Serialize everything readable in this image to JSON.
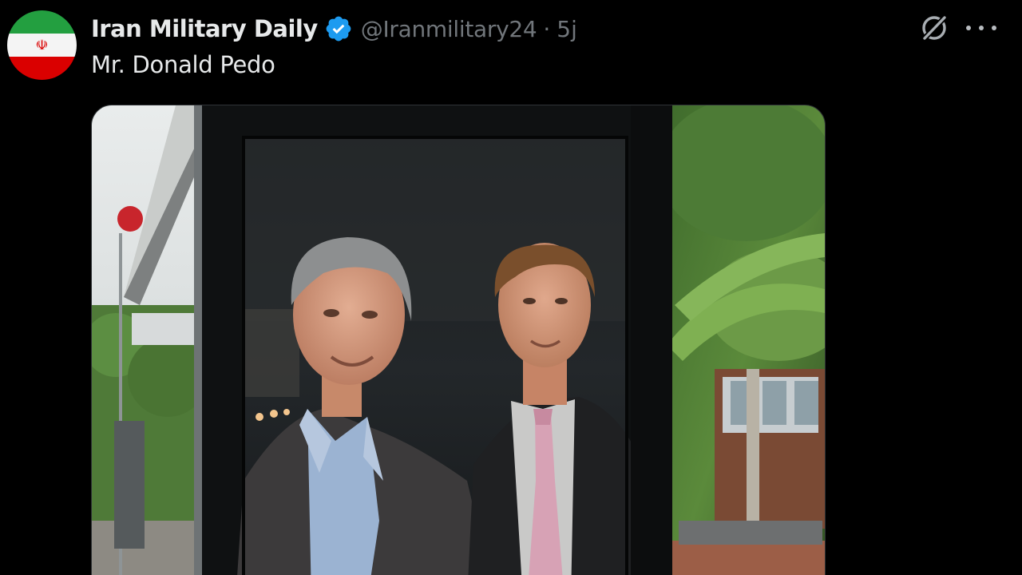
{
  "post": {
    "account_name": "Iran Military Daily",
    "handle": "@Iranmilitary24",
    "separator": "·",
    "timestamp": "5j",
    "text": "Mr. Donald Pedo",
    "verified": true
  },
  "icons": {
    "avatar": "iran-flag-avatar",
    "verified_badge": "verified-badge-icon",
    "grok": "grok-icon",
    "more": "more-options-icon"
  },
  "colors": {
    "background": "#000000",
    "primary_text": "#e7e9ea",
    "secondary_text": "#71767b",
    "verified": "#1d9bf0",
    "flag_green": "#239f40",
    "flag_white": "#ffffff",
    "flag_red": "#da0000"
  }
}
